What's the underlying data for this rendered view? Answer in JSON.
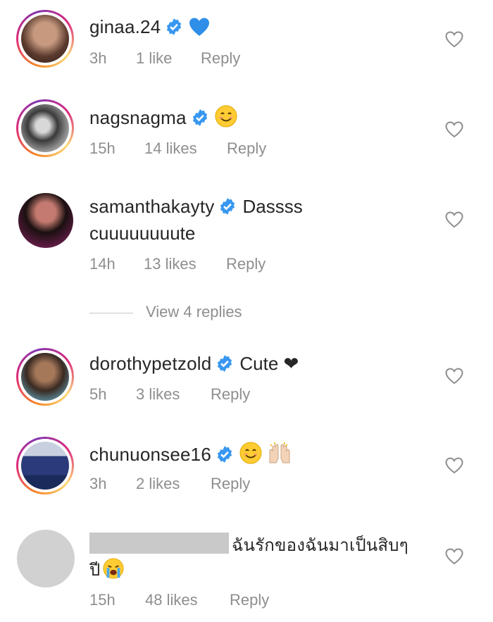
{
  "comments": [
    {
      "username": "ginaa.24",
      "text": "",
      "emoji": "blue-heart",
      "time": "3h",
      "likes": "1 like",
      "reply": "Reply",
      "avatar_color": "#7a5a4a"
    },
    {
      "username": "nagsnagma",
      "text": "",
      "emoji": "smiling-face",
      "time": "15h",
      "likes": "14 likes",
      "reply": "Reply",
      "avatar_color": "#4a4a4a"
    },
    {
      "username": "samanthakayty",
      "text": "Dassss",
      "text2": "cuuuuuuuute",
      "time": "14h",
      "likes": "13 likes",
      "reply": "Reply",
      "avatar_color": "#7a2a5a"
    },
    {
      "username": "dorothypetzold",
      "text": "Cute ❤",
      "emoji": "",
      "time": "5h",
      "likes": "3 likes",
      "reply": "Reply",
      "avatar_color": "#6b8a9a"
    },
    {
      "username": "chunuonsee16",
      "text": "",
      "emoji": "smiling-face raised-hands",
      "time": "3h",
      "likes": "2 likes",
      "reply": "Reply",
      "avatar_color": "#2a3a6a"
    },
    {
      "username": "",
      "text": "ฉันรักของฉันมาเป็นสิบๆ",
      "text2": "ปี",
      "emoji": "loudly-crying-face",
      "time": "15h",
      "likes": "48 likes",
      "reply": "Reply",
      "avatar_color": "#d1d1d1"
    }
  ],
  "view_replies": "View 4 replies",
  "colors": {
    "verified": "#3897f0",
    "meta": "#8e8e8e",
    "text": "#262626"
  }
}
